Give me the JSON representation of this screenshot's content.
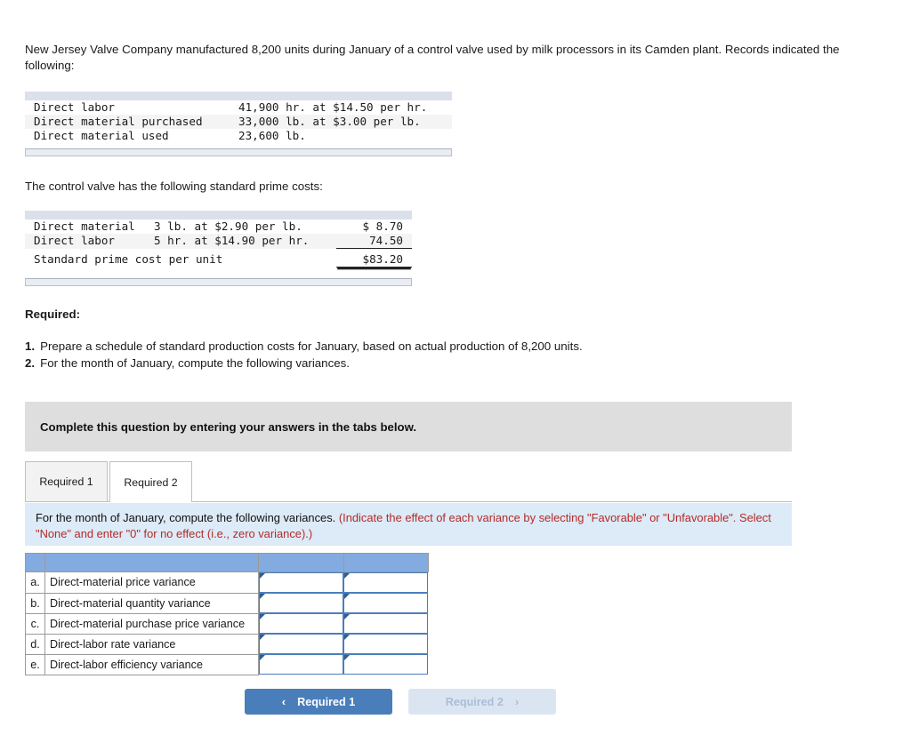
{
  "problem": {
    "intro": "New Jersey Valve Company manufactured 8,200 units during January of a control valve used by milk processors in its Camden plant. Records indicated the following:",
    "actuals_table": {
      "rows": [
        {
          "label": "Direct labor",
          "detail": "41,900 hr. at $14.50 per hr."
        },
        {
          "label": "Direct material purchased",
          "detail": "33,000 lb. at $3.00 per lb."
        },
        {
          "label": "Direct material used",
          "detail": "23,600 lb."
        }
      ]
    },
    "standards_intro": "The control valve has the following standard prime costs:",
    "standards_table": {
      "rows": [
        {
          "label": "Direct material",
          "detail": "3 lb. at $2.90 per lb.",
          "amount": "$ 8.70"
        },
        {
          "label": "Direct labor",
          "detail": "5 hr. at $14.90 per hr.",
          "amount": "74.50"
        }
      ],
      "total_label": "Standard prime cost per unit",
      "total_amount": "$83.20"
    },
    "required_heading": "Required:",
    "required_items": [
      {
        "num": "1.",
        "text": "Prepare a schedule of standard production costs for January, based on actual production of 8,200 units."
      },
      {
        "num": "2.",
        "text": "For the month of January, compute the following variances."
      }
    ]
  },
  "banner": {
    "text": "Complete this question by entering your answers in the tabs below."
  },
  "tabs": [
    {
      "label": "Required 1",
      "active": false
    },
    {
      "label": "Required 2",
      "active": true
    }
  ],
  "callout": {
    "black_text": "For the month of January, compute the following variances. ",
    "red_text": "(Indicate the effect of each variance by selecting \"Favorable\" or \"Unfavorable\". Select \"None\" and enter \"0\" for no effect (i.e., zero variance).)"
  },
  "answer_table": {
    "rows": [
      {
        "index": "a.",
        "label": "Direct-material price variance",
        "value": "",
        "effect": ""
      },
      {
        "index": "b.",
        "label": "Direct-material quantity variance",
        "value": "",
        "effect": ""
      },
      {
        "index": "c.",
        "label": "Direct-material purchase price variance",
        "value": "",
        "effect": ""
      },
      {
        "index": "d.",
        "label": "Direct-labor rate variance",
        "value": "",
        "effect": ""
      },
      {
        "index": "e.",
        "label": "Direct-labor efficiency variance",
        "value": "",
        "effect": ""
      }
    ]
  },
  "nav": {
    "prev_label": "Required 1",
    "prev_chevron": "‹",
    "next_label": "Required 2",
    "next_chevron": "›"
  },
  "colors": {
    "accent_blue": "#4a7ebb",
    "header_blue": "#83abe0",
    "callout_bg": "#ddeaf7",
    "banner_gray": "#dedede",
    "red_text": "#b52b27"
  }
}
